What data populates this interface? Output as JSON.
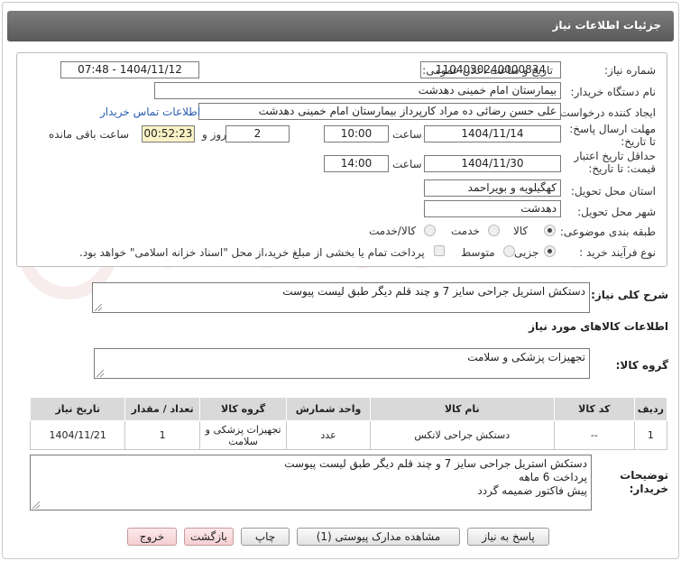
{
  "page": {
    "title": "جزئیات اطلاعات نیاز"
  },
  "form": {
    "need_number": {
      "label": "شماره نیاز:",
      "value": "1104030240000834"
    },
    "announce_datetime": {
      "label": "تاریخ و ساعت اعلان عمومی:",
      "value": "1404/11/12 - 07:48"
    },
    "buyer_org": {
      "label": "نام دستگاه خریدار:",
      "value": "بیمارستان امام خمینی دهدشت"
    },
    "requester": {
      "label": "ایجاد کننده درخواست:",
      "value": "علی حسن رضائی ده مراد کارپرداز بیمارستان امام خمینی دهدشت"
    },
    "contact_link": "اطلاعات تماس خریدار",
    "deadline": {
      "label": "مهلت ارسال پاسخ: تا تاریخ:",
      "date": "1404/11/14",
      "time_label": "ساعت",
      "time": "10:00",
      "days": "2",
      "days_label": "روز و",
      "remaining": "00:52:23",
      "remaining_label": "ساعت باقی مانده"
    },
    "validity": {
      "label": "حداقل تاریخ اعتبار قیمت: تا تاریخ:",
      "date": "1404/11/30",
      "time_label": "ساعت",
      "time": "14:00"
    },
    "province": {
      "label": "استان محل تحویل:",
      "value": "کهگیلویه و بویراحمد"
    },
    "city": {
      "label": "شهر محل تحویل:",
      "value": "دهدشت"
    },
    "category": {
      "label": "طبقه بندی موضوعی:",
      "options": [
        "کالا",
        "خدمت",
        "کالا/خدمت"
      ],
      "selected": "کالا"
    },
    "purchase_type": {
      "label": "نوع فرآیند خرید :",
      "options": [
        "جزیی",
        "متوسط"
      ],
      "selected": "جزیی",
      "treasury_note": "پرداخت تمام یا بخشی از مبلغ خرید،از محل \"اسناد خزانه اسلامی\" خواهد بود."
    }
  },
  "summary": {
    "label": "شرح کلی نیاز:",
    "value": "دستکش استریل جراحی سایز 7 و چند قلم دیگر طبق لیست پیوست"
  },
  "goods_section": {
    "title": "اطلاعات کالاهای مورد نیاز",
    "group_label": "گروه کالا:",
    "group_value": "تجهیزات پزشکی و سلامت"
  },
  "items_table": {
    "headers": [
      "ردیف",
      "کد کالا",
      "نام کالا",
      "واحد شمارش",
      "گروه کالا",
      "تعداد / مقدار",
      "تاریخ نیاز"
    ],
    "rows": [
      [
        "1",
        "--",
        "دستکش جراحی لاتکس",
        "عدد",
        "تجهیزات پزشکی و سلامت",
        "1",
        "1404/11/21"
      ]
    ]
  },
  "buyer_notes": {
    "label": "توضیحات خریدار:",
    "lines": [
      "دستکش استریل جراحی سایز 7 و چند قلم دیگر طبق لیست پیوست",
      "پرداخت 6 ماهه",
      "پیش فاکتور ضمیمه گردد"
    ]
  },
  "buttons": {
    "reply": "پاسخ به نیاز",
    "attachments": "مشاهده مدارک پیوستی (1)",
    "print": "چاپ",
    "back": "بازگشت",
    "exit": "خروج"
  },
  "watermark": "AriaTender.net"
}
